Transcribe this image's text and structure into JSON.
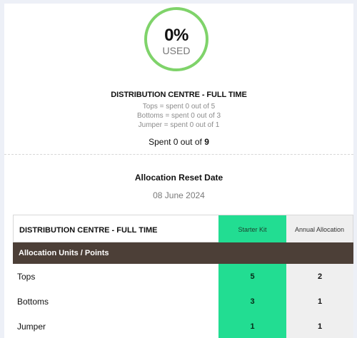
{
  "summary": {
    "used_percent": "0%",
    "used_label": "USED",
    "title": "DISTRIBUTION CENTRE - FULL TIME",
    "lines": [
      "Tops = spent 0 out of 5",
      "Bottoms = spent 0 out of 3",
      "Jumper = spent 0 out of 1"
    ],
    "spent_prefix": "Spent 0 out of",
    "spent_total": "9"
  },
  "reset": {
    "title": "Allocation Reset Date",
    "date": "08 June 2024"
  },
  "table": {
    "header": {
      "title": "DISTRIBUTION CENTRE - FULL TIME",
      "starter_kit": "Starter Kit",
      "annual_allocation": "Annual Allocation"
    },
    "section_label": "Allocation Units / Points",
    "rows": [
      {
        "label": "Tops",
        "starter": "5",
        "annual": "2"
      },
      {
        "label": "Bottoms",
        "starter": "3",
        "annual": "1"
      },
      {
        "label": "Jumper",
        "starter": "1",
        "annual": "1"
      }
    ]
  },
  "colors": {
    "page_background": "#edf0f7",
    "gauge_ring": "#7fd36a",
    "starter_kit": "#22dd92",
    "annual_allocation": "#efefef",
    "section_bar": "#4c3f37"
  }
}
